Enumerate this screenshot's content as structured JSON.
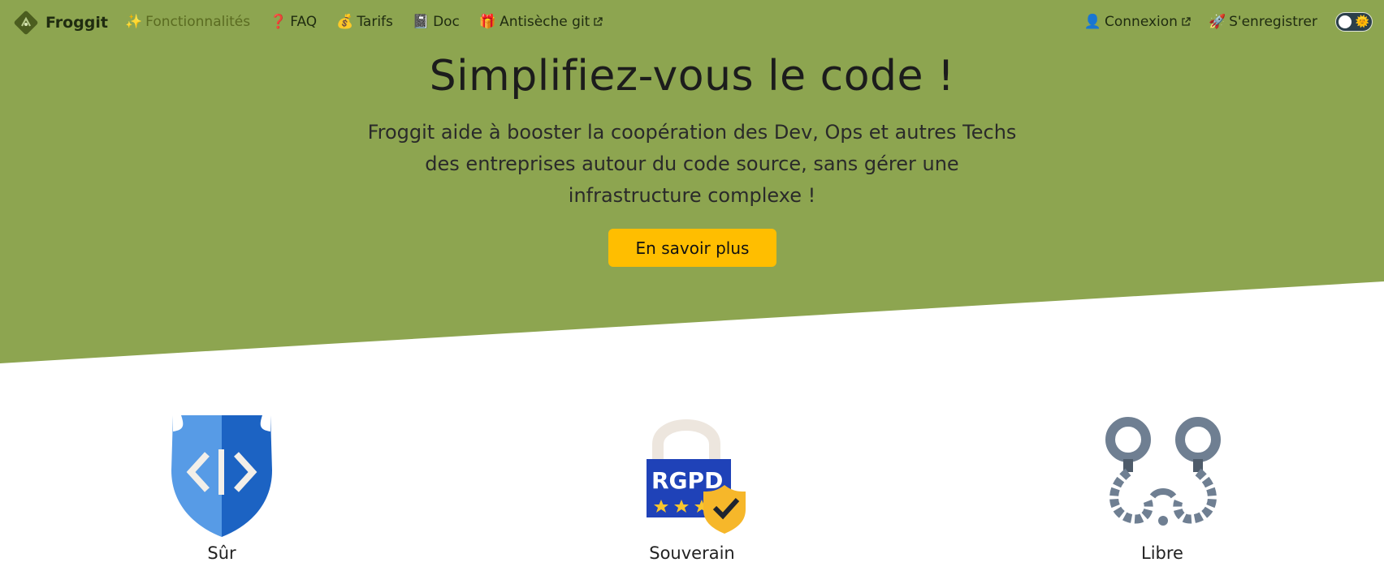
{
  "brand": {
    "name": "Froggit"
  },
  "nav": {
    "links": [
      {
        "emoji": "✨",
        "label": "Fonctionnalités",
        "active": true
      },
      {
        "emoji": "❓",
        "label": "FAQ"
      },
      {
        "emoji": "💰",
        "label": "Tarifs"
      },
      {
        "emoji": "📓",
        "label": "Doc"
      },
      {
        "emoji": "🎁",
        "label": "Antisèche git",
        "external": true
      }
    ],
    "right": [
      {
        "emoji": "👤",
        "label": "Connexion",
        "external": true
      },
      {
        "emoji": "🚀",
        "label": "S'enregistrer"
      }
    ],
    "theme_toggle": {
      "icon": "🌞"
    }
  },
  "hero": {
    "title": "Simplifiez-vous le code !",
    "subtitle": "Froggit aide à booster la coopération des Dev, Ops et autres Techs des entreprises autour du code source, sans gérer une infrastructure complexe !",
    "cta_label": "En savoir plus"
  },
  "features": [
    {
      "icon": "code-shield-icon",
      "label": "Sûr"
    },
    {
      "icon": "rgpd-lock-icon",
      "label": "Souverain",
      "badge_text": "RGPD"
    },
    {
      "icon": "open-handcuffs-icon",
      "label": "Libre"
    }
  ],
  "colors": {
    "hero_bg": "#8da550",
    "cta_bg": "#ffbe00",
    "active_nav": "#5a6b21"
  }
}
